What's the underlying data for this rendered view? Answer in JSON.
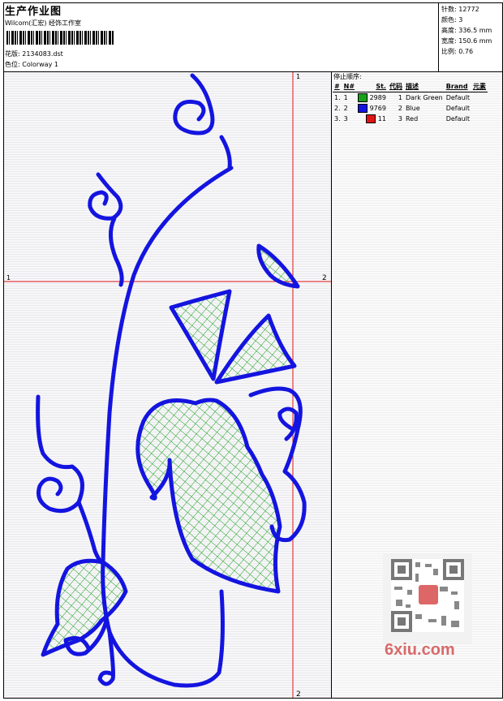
{
  "header": {
    "title": "生产作业图",
    "studio": "Wilcom(汇宏) 经饰工作室",
    "design_label": "花版:",
    "design_value": "2134083.dst",
    "colorway_label": "色位:",
    "colorway_value": "Colorway 1"
  },
  "stats": [
    {
      "label": "针数:",
      "value": "12772"
    },
    {
      "label": "颜色:",
      "value": "3"
    },
    {
      "label": "高度:",
      "value": "336.5 mm"
    },
    {
      "label": "宽度:",
      "value": "150.6 mm"
    },
    {
      "label": "比例:",
      "value": "0.76"
    }
  ],
  "legend": {
    "title": "停止顺序:",
    "columns": [
      "#",
      "N#",
      "St.",
      "代码",
      "描述",
      "Brand",
      "元素"
    ],
    "rows": [
      {
        "idx": "1.",
        "n": "1",
        "color": "#18a018",
        "stitches": "2989",
        "code": "1",
        "desc": "Dark Green",
        "brand": "Default"
      },
      {
        "idx": "2.",
        "n": "2",
        "color": "#1414e0",
        "stitches": "9769",
        "code": "2",
        "desc": "Blue",
        "brand": "Default"
      },
      {
        "idx": "3.",
        "n": "3",
        "color": "#e01414",
        "stitches": "11",
        "code": "3",
        "desc": "Red",
        "brand": "Default"
      }
    ]
  },
  "axes": {
    "h_start": "1",
    "h_end": "2",
    "v_start": "1",
    "v_end": "2"
  },
  "watermark": "6xiu.com"
}
